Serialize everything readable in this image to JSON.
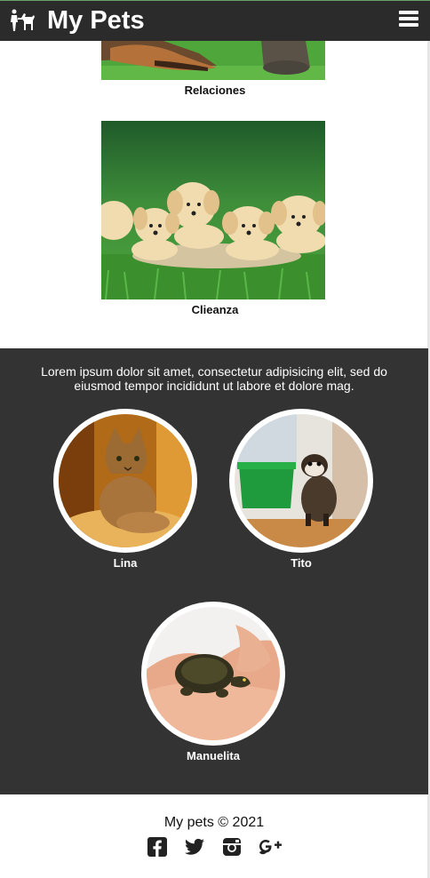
{
  "header": {
    "title": "My Pets",
    "logo_icon": "pets-logo-icon",
    "menu_icon": "hamburger-menu-icon"
  },
  "gallery": [
    {
      "caption": "Relaciones"
    },
    {
      "caption": "Clieanza"
    }
  ],
  "section": {
    "text": "Lorem ipsum dolor sit amet, consectetur adipisicing elit, sed do eiusmod tempor incididunt ut labore et dolore mag.",
    "pets": [
      {
        "name": "Lina"
      },
      {
        "name": "Tito"
      },
      {
        "name": "Manuelita"
      }
    ]
  },
  "footer": {
    "copyright": "My pets © 2021",
    "social_icons": [
      "facebook-icon",
      "twitter-icon",
      "instagram-icon",
      "google-plus-icon"
    ]
  },
  "colors": {
    "header_bg": "#2b2b2b",
    "section_bg": "#333333"
  }
}
